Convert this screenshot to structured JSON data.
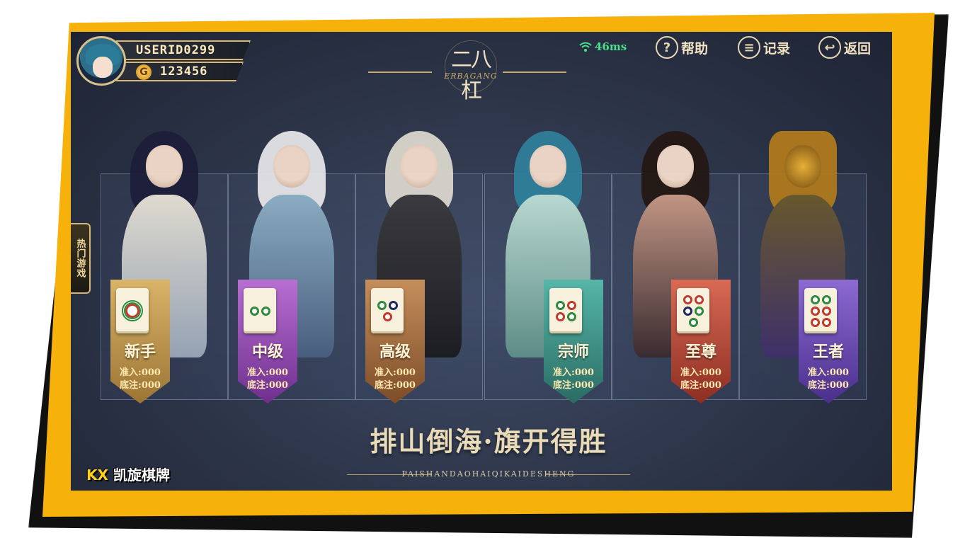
{
  "user": {
    "id": "USERID0299",
    "coins": "123456",
    "coin_icon": "G"
  },
  "logo": {
    "title": "二八杠",
    "subtitle": "ERBAGANG"
  },
  "status": {
    "ping": "46ms"
  },
  "toolbar": {
    "help_label": "帮助",
    "records_label": "记录",
    "back_label": "返回"
  },
  "hot_games_label": "热门游戏",
  "rooms": [
    {
      "name": "新手",
      "entry": "准入:000",
      "base": "底注:000",
      "color": "#c9a055"
    },
    {
      "name": "中级",
      "entry": "准入:000",
      "base": "底注:000",
      "color": "#9b4fb0"
    },
    {
      "name": "高级",
      "entry": "准入:000",
      "base": "底注:000",
      "color": "#b27a4a"
    },
    {
      "name": "宗师",
      "entry": "准入:000",
      "base": "底注:000",
      "color": "#3e9a8e"
    },
    {
      "name": "至尊",
      "entry": "准入:000",
      "base": "底注:000",
      "color": "#c0503e"
    },
    {
      "name": "王者",
      "entry": "准入:000",
      "base": "底注:000",
      "color": "#6f4fb0"
    }
  ],
  "slogan": {
    "main": "排山倒海·旗开得胜",
    "sub": "PAISHANDAOHAIQIKAIDESHENG"
  },
  "brand": {
    "kx": "KX",
    "name": "凯旋棋牌"
  },
  "colors": {
    "frame": "#f6b10a",
    "accent_gold": "#d9b777",
    "ping_green": "#4be08a"
  }
}
